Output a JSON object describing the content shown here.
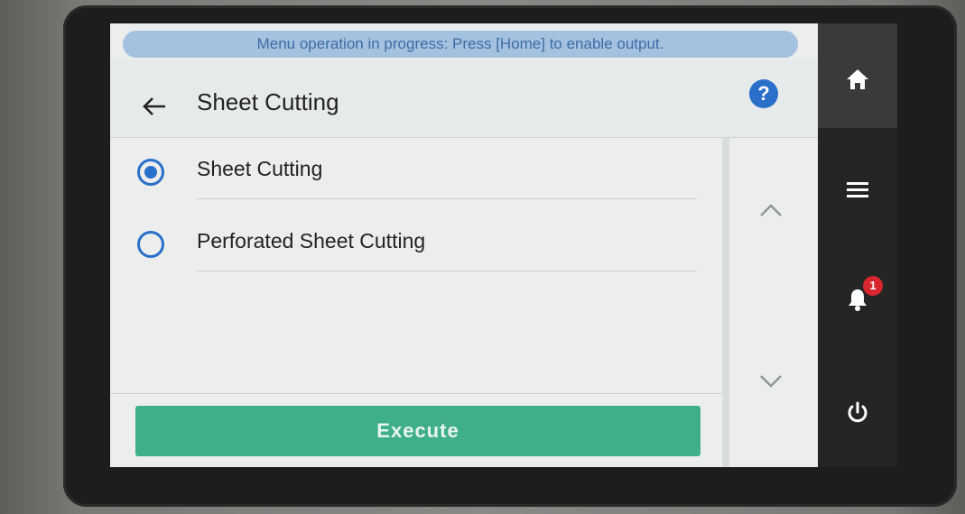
{
  "banner": {
    "text": "Menu operation in progress: Press [Home] to enable output."
  },
  "header": {
    "title": "Sheet Cutting"
  },
  "options": [
    {
      "label": "Sheet Cutting",
      "selected": true
    },
    {
      "label": "Perforated Sheet Cutting",
      "selected": false
    }
  ],
  "actions": {
    "execute_label": "Execute"
  },
  "sidebar": {
    "items": [
      {
        "icon": "home-icon"
      },
      {
        "icon": "menu-icon"
      },
      {
        "icon": "bell-icon"
      },
      {
        "icon": "power-icon"
      }
    ],
    "notification_count": "1"
  },
  "colors": {
    "accent": "#2a6fc9",
    "execute": "#3fae8a",
    "banner": "#a4c1df",
    "badge": "#d8262e"
  }
}
